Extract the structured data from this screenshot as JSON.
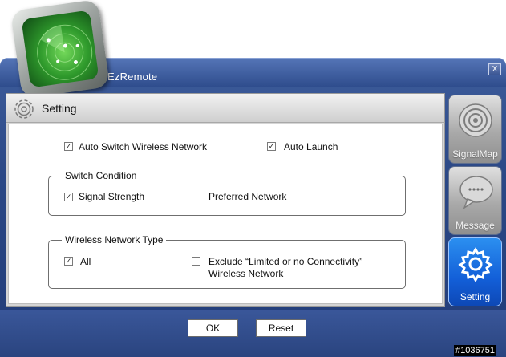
{
  "app": {
    "title": "EzRemote",
    "close_label": "X"
  },
  "panel": {
    "title": "Setting"
  },
  "options": {
    "auto_switch": {
      "label": "Auto Switch Wireless Network",
      "checked": true
    },
    "auto_launch": {
      "label": "Auto Launch",
      "checked": true
    }
  },
  "switch_condition": {
    "title": "Switch Condition",
    "signal_strength": {
      "label": "Signal Strength",
      "checked": true
    },
    "preferred_network": {
      "label": "Preferred Network",
      "checked": false
    }
  },
  "network_type": {
    "title": "Wireless Network Type",
    "all": {
      "label": "All",
      "checked": true
    },
    "exclude": {
      "label_line1": "Exclude “Limited or no Connectivity”",
      "label_line2": "Wireless Network",
      "checked": false
    }
  },
  "sidebar": {
    "items": [
      {
        "label": "SignalMap",
        "icon": "radar-icon",
        "active": false
      },
      {
        "label": "Message",
        "icon": "chat-icon",
        "active": false
      },
      {
        "label": "Setting",
        "icon": "gear-icon",
        "active": true
      }
    ]
  },
  "buttons": {
    "ok": "OK",
    "reset": "Reset"
  },
  "watermark": "#1036751",
  "check_glyph": "✓"
}
